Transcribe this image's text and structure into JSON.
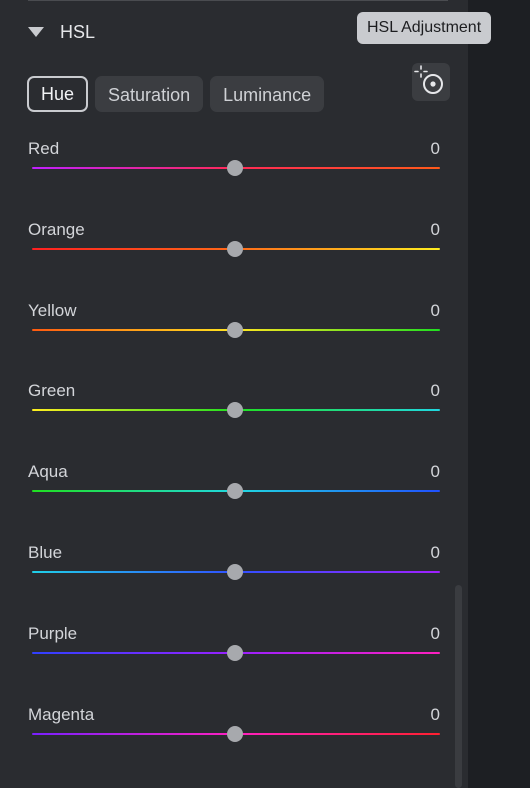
{
  "section": {
    "title": "HSL",
    "tooltip": "HSL Adjustment"
  },
  "tabs": [
    {
      "label": "Hue",
      "active": true
    },
    {
      "label": "Saturation",
      "active": false
    },
    {
      "label": "Luminance",
      "active": false
    }
  ],
  "target_icon": "targeted-adjustment-icon",
  "sliders": [
    {
      "label": "Red",
      "value": "0",
      "level": 0.5,
      "colors": [
        "#c020ff",
        "#ff2a55",
        "#ff5a1a"
      ]
    },
    {
      "label": "Orange",
      "value": "0",
      "level": 0.5,
      "colors": [
        "#ff2020",
        "#ff6a18",
        "#ffee20"
      ]
    },
    {
      "label": "Yellow",
      "value": "0",
      "level": 0.5,
      "colors": [
        "#ff5a10",
        "#ffe620",
        "#20e020"
      ]
    },
    {
      "label": "Green",
      "value": "0",
      "level": 0.5,
      "colors": [
        "#ffee20",
        "#20e020",
        "#20d8e0"
      ]
    },
    {
      "label": "Aqua",
      "value": "0",
      "level": 0.5,
      "colors": [
        "#20e020",
        "#20d8e0",
        "#2050ff"
      ]
    },
    {
      "label": "Blue",
      "value": "0",
      "level": 0.5,
      "colors": [
        "#20d0e8",
        "#3050ff",
        "#a020ff"
      ]
    },
    {
      "label": "Purple",
      "value": "0",
      "level": 0.5,
      "colors": [
        "#3040ff",
        "#9a20ff",
        "#ff20c0"
      ]
    },
    {
      "label": "Magenta",
      "value": "0",
      "level": 0.5,
      "colors": [
        "#7a20ff",
        "#ff20c0",
        "#ff2030"
      ]
    }
  ]
}
